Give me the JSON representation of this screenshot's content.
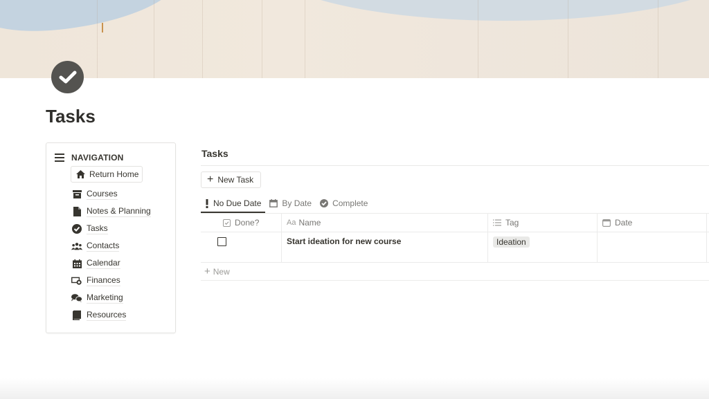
{
  "page": {
    "title": "Tasks",
    "icon": "check-circle-icon"
  },
  "navigation": {
    "heading": "NAVIGATION",
    "menu_icon": "hamburger-icon",
    "return_home": {
      "label": "Return Home",
      "icon": "home-icon"
    },
    "items": [
      {
        "label": "Courses",
        "icon": "archive-box-icon"
      },
      {
        "label": "Notes & Planning",
        "icon": "document-icon"
      },
      {
        "label": "Tasks",
        "icon": "check-circle-icon"
      },
      {
        "label": "Contacts",
        "icon": "people-icon"
      },
      {
        "label": "Calendar",
        "icon": "calendar-icon"
      },
      {
        "label": "Finances",
        "icon": "money-icon"
      },
      {
        "label": "Marketing",
        "icon": "chat-bubbles-icon"
      },
      {
        "label": "Resources",
        "icon": "book-icon"
      }
    ]
  },
  "database": {
    "title": "Tasks",
    "new_button": "New Task",
    "views": [
      {
        "label": "No Due Date",
        "icon": "exclamation-icon",
        "active": true
      },
      {
        "label": "By Date",
        "icon": "calendar-icon",
        "active": false
      },
      {
        "label": "Complete",
        "icon": "check-circle-icon",
        "active": false
      }
    ],
    "columns": [
      {
        "label": "Done?",
        "icon": "checkbox-icon"
      },
      {
        "label": "Name",
        "icon": "text-aa-icon"
      },
      {
        "label": "Tag",
        "icon": "list-icon"
      },
      {
        "label": "Date",
        "icon": "calendar-icon"
      }
    ],
    "rows": [
      {
        "done": false,
        "name": "Start ideation for new course",
        "tag": "Ideation",
        "date": ""
      }
    ],
    "new_row_label": "New",
    "text_aa": "Aa"
  },
  "colors": {
    "text": "#37352f",
    "muted": "#787774",
    "border": "#e9e9e7",
    "tag_bg": "#e9e9e7",
    "icon_dark": "#545350"
  }
}
